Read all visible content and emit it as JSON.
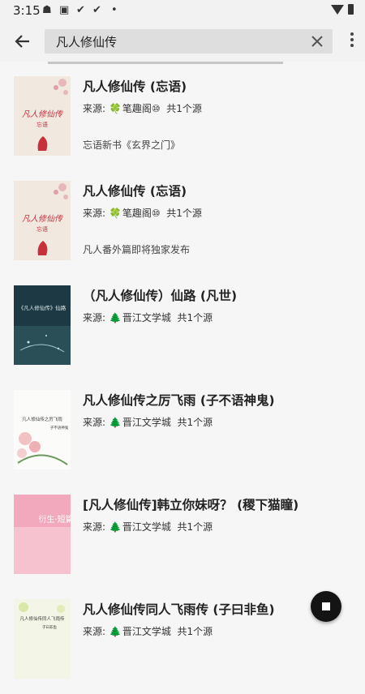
{
  "status_bar": {
    "time": "3:15",
    "icons": [
      "notification-icon",
      "a-badge-icon",
      "check-icon",
      "check-icon",
      "dot-icon",
      "wifi-icon",
      "battery-icon"
    ]
  },
  "search": {
    "value": "凡人修仙传"
  },
  "results": [
    {
      "title": "凡人修仙传 (忘语)",
      "source_prefix": "来源: ",
      "source_name": "笔趣阁⑩",
      "source_count": "共1个源",
      "intro": "忘语新书《玄界之门》",
      "cover_text": "凡人修仙传",
      "cover_sub": "忘语"
    },
    {
      "title": "凡人修仙传 (忘语)",
      "source_prefix": "来源: ",
      "source_name": "笔趣阁⑩",
      "source_count": "共1个源",
      "intro": "凡人番外篇即将独家发布",
      "cover_text": "凡人修仙传",
      "cover_sub": "忘语"
    },
    {
      "title": "（凡人修仙传）仙路 (凡世)",
      "source_prefix": "来源: ",
      "source_name": "晋江文学城",
      "source_count": "共1个源",
      "intro": "",
      "cover_text": "《凡人修仙传》仙路",
      "cover_sub": ""
    },
    {
      "title": "凡人修仙传之厉飞雨 (子不语神鬼)",
      "source_prefix": "来源: ",
      "source_name": "晋江文学城",
      "source_count": "共1个源",
      "intro": "",
      "cover_text": "凡人修仙传之厉飞雨",
      "cover_sub": "子不语神鬼"
    },
    {
      "title": "[凡人修仙传]韩立你妹呀？ (稷下猫瞳)",
      "source_prefix": "来源: ",
      "source_name": "晋江文学城",
      "source_count": "共1个源",
      "intro": "",
      "cover_text": "衍生·短篇",
      "cover_sub": ""
    },
    {
      "title": "凡人修仙传同人飞雨传 (子曰非鱼)",
      "source_prefix": "来源: ",
      "source_name": "晋江文学城",
      "source_count": "共1个源",
      "intro": "",
      "cover_text": "凡人修仙传同人飞雨传",
      "cover_sub": "子曰非鱼"
    }
  ],
  "colors": {
    "accent_red": "#c8313c",
    "background": "#f6f6f6",
    "searchbox": "#dedede",
    "fab": "#141414"
  }
}
